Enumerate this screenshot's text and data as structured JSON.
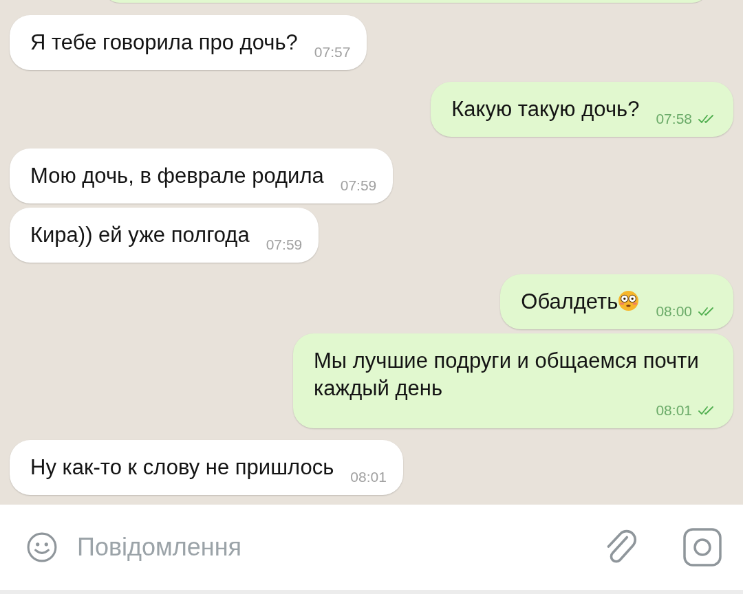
{
  "messages": [
    {
      "outgoing": false,
      "text": "Я тебе говорила про дочь?",
      "time": "07:57"
    },
    {
      "outgoing": true,
      "text": "Какую такую дочь?",
      "time": "07:58",
      "read": true
    },
    {
      "outgoing": false,
      "text": "Мою дочь, в феврале родила",
      "time": "07:59"
    },
    {
      "outgoing": false,
      "text": "Кира)) ей уже полгода",
      "time": "07:59"
    },
    {
      "outgoing": true,
      "text": "Обалдеть",
      "emoji": true,
      "time": "08:00",
      "read": true
    },
    {
      "outgoing": true,
      "text": "Мы лучшие подруги и общаемся почти каждый день",
      "time": "08:01",
      "read": true
    },
    {
      "outgoing": false,
      "text": "Ну как-то к слову не пришлось",
      "time": "08:01"
    }
  ],
  "composer": {
    "placeholder": "Повідомлення"
  }
}
